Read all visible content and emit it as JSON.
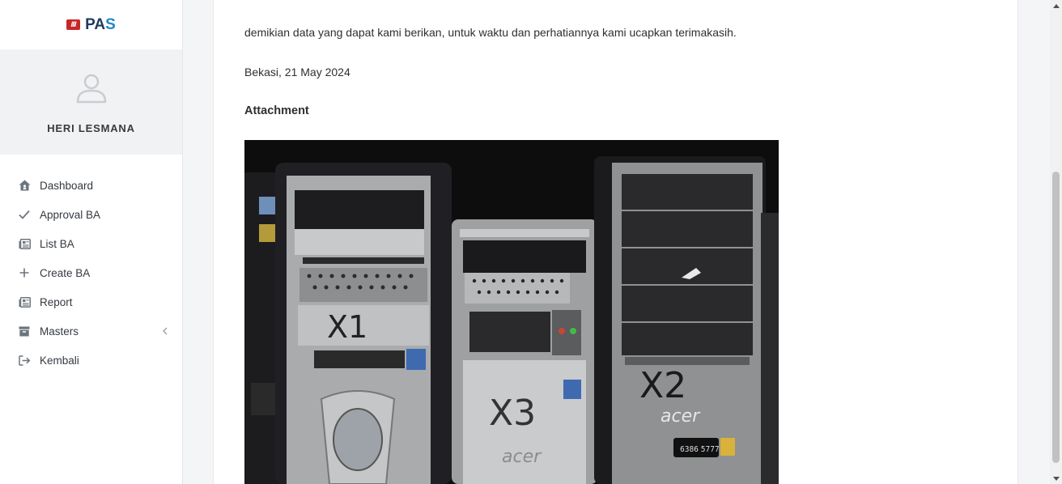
{
  "brand": {
    "name_part1": "PA",
    "name_part2": "S",
    "logo_glyph": "////"
  },
  "user": {
    "name": "HERI LESMANA"
  },
  "sidebar": {
    "items": [
      {
        "label": "Dashboard",
        "icon": "home-icon"
      },
      {
        "label": "Approval BA",
        "icon": "check-icon"
      },
      {
        "label": "List BA",
        "icon": "newspaper-icon"
      },
      {
        "label": "Create BA",
        "icon": "plus-icon"
      },
      {
        "label": "Report",
        "icon": "newspaper-icon"
      },
      {
        "label": "Masters",
        "icon": "archive-icon",
        "has_submenu": true
      },
      {
        "label": "Kembali",
        "icon": "sign-out-icon"
      }
    ]
  },
  "document": {
    "closing_text": "demikian data yang dapat kami berikan, untuk waktu dan perhatiannya kami ucapkan terimakasih.",
    "place_date": "Bekasi, 21 May 2024",
    "attachment_label": "Attachment"
  },
  "photo": {
    "labels": [
      "X1",
      "X3",
      "X2"
    ],
    "brand_text": "acer",
    "phone_text": "6386 5777"
  },
  "colors": {
    "brand_red": "#c62828",
    "brand_blue": "#1e88c8",
    "brand_navy": "#1e3a5f"
  }
}
